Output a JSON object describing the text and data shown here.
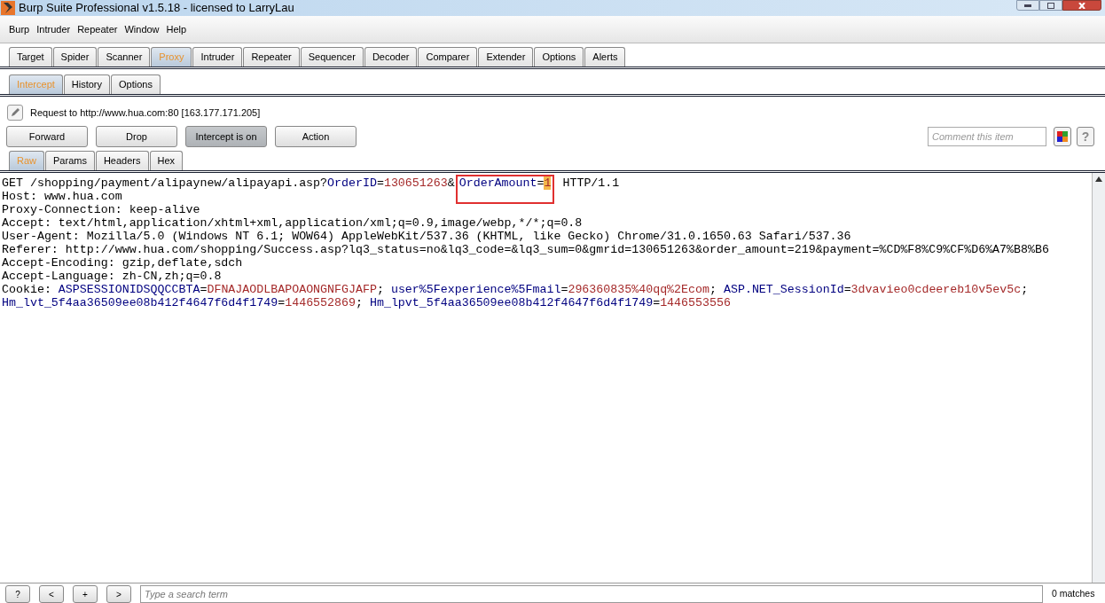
{
  "window": {
    "title": "Burp Suite Professional v1.5.18 - licensed to LarryLau"
  },
  "menu": [
    "Burp",
    "Intruder",
    "Repeater",
    "Window",
    "Help"
  ],
  "tabs": [
    {
      "label": "Target",
      "selected": false
    },
    {
      "label": "Spider",
      "selected": false
    },
    {
      "label": "Scanner",
      "selected": false
    },
    {
      "label": "Proxy",
      "selected": true
    },
    {
      "label": "Intruder",
      "selected": false
    },
    {
      "label": "Repeater",
      "selected": false
    },
    {
      "label": "Sequencer",
      "selected": false
    },
    {
      "label": "Decoder",
      "selected": false
    },
    {
      "label": "Comparer",
      "selected": false
    },
    {
      "label": "Extender",
      "selected": false
    },
    {
      "label": "Options",
      "selected": false
    },
    {
      "label": "Alerts",
      "selected": false
    }
  ],
  "subtabs": [
    {
      "label": "Intercept",
      "selected": true
    },
    {
      "label": "History",
      "selected": false
    },
    {
      "label": "Options",
      "selected": false
    }
  ],
  "request_info": "Request to http://www.hua.com:80  [163.177.171.205]",
  "buttons": [
    {
      "label": "Forward",
      "on": false
    },
    {
      "label": "Drop",
      "on": false
    },
    {
      "label": "Intercept is on",
      "on": true
    },
    {
      "label": "Action",
      "on": false
    }
  ],
  "comment": {
    "placeholder": "Comment this item"
  },
  "help_label": "?",
  "editor_tabs": [
    {
      "label": "Raw",
      "selected": true
    },
    {
      "label": "Params",
      "selected": false
    },
    {
      "label": "Headers",
      "selected": false
    },
    {
      "label": "Hex",
      "selected": false
    }
  ],
  "request_lines": [
    {
      "segments": [
        {
          "kind": "plain",
          "text": "GET /shopping/payment/alipaynew/alipayapi.asp?"
        },
        {
          "kind": "name",
          "text": "OrderID"
        },
        {
          "kind": "plain",
          "text": "="
        },
        {
          "kind": "value",
          "text": "130651263"
        },
        {
          "kind": "plain",
          "text": "&"
        },
        {
          "kind": "name",
          "text": "OrderAmount",
          "boxed": true
        },
        {
          "kind": "plain",
          "text": "=",
          "boxed": true
        },
        {
          "kind": "highlight",
          "text": "1",
          "boxed": true
        },
        {
          "kind": "plain",
          "text": " HTTP/1.1"
        }
      ]
    },
    {
      "segments": [
        {
          "kind": "plain",
          "text": "Host: www.hua.com"
        }
      ]
    },
    {
      "segments": [
        {
          "kind": "plain",
          "text": "Proxy-Connection: keep-alive"
        }
      ]
    },
    {
      "segments": [
        {
          "kind": "plain",
          "text": "Accept: text/html,application/xhtml+xml,application/xml;q=0.9,image/webp,*/*;q=0.8"
        }
      ]
    },
    {
      "segments": [
        {
          "kind": "plain",
          "text": "User-Agent: Mozilla/5.0 (Windows NT 6.1; WOW64) AppleWebKit/537.36 (KHTML, like Gecko) Chrome/31.0.1650.63 Safari/537.36"
        }
      ]
    },
    {
      "segments": [
        {
          "kind": "plain",
          "text": "Referer: http://www.hua.com/shopping/Success.asp?lq3_status=no&lq3_code=&lq3_sum=0&gmrid=130651263&order_amount=219&payment=%CD%F8%C9%CF%D6%A7%B8%B6"
        }
      ]
    },
    {
      "segments": [
        {
          "kind": "plain",
          "text": "Accept-Encoding: gzip,deflate,sdch"
        }
      ]
    },
    {
      "segments": [
        {
          "kind": "plain",
          "text": "Accept-Language: zh-CN,zh;q=0.8"
        }
      ]
    },
    {
      "segments": [
        {
          "kind": "plain",
          "text": "Cookie: "
        },
        {
          "kind": "name",
          "text": "ASPSESSIONIDSQQCCBTA"
        },
        {
          "kind": "plain",
          "text": "="
        },
        {
          "kind": "value",
          "text": "DFNAJAODLBAPOAONGNFGJAFP"
        },
        {
          "kind": "plain",
          "text": "; "
        },
        {
          "kind": "name",
          "text": "user%5Fexperience%5Fmail"
        },
        {
          "kind": "plain",
          "text": "="
        },
        {
          "kind": "value",
          "text": "296360835%40qq%2Ecom"
        },
        {
          "kind": "plain",
          "text": "; "
        },
        {
          "kind": "name",
          "text": "ASP.NET_SessionId"
        },
        {
          "kind": "plain",
          "text": "="
        },
        {
          "kind": "value",
          "text": "3dvavieo0cdeereb10v5ev5c"
        },
        {
          "kind": "plain",
          "text": ";"
        }
      ]
    },
    {
      "segments": [
        {
          "kind": "name",
          "text": "Hm_lvt_5f4aa36509ee08b412f4647f6d4f1749"
        },
        {
          "kind": "plain",
          "text": "="
        },
        {
          "kind": "value",
          "text": "1446552869"
        },
        {
          "kind": "plain",
          "text": "; "
        },
        {
          "kind": "name",
          "text": "Hm_lpvt_5f4aa36509ee08b412f4647f6d4f1749"
        },
        {
          "kind": "plain",
          "text": "="
        },
        {
          "kind": "value",
          "text": "1446553556"
        }
      ]
    }
  ],
  "search_bar": {
    "buttons": [
      "?",
      "<",
      "+",
      ">"
    ],
    "placeholder": "Type a search term",
    "matches": "0 matches"
  }
}
